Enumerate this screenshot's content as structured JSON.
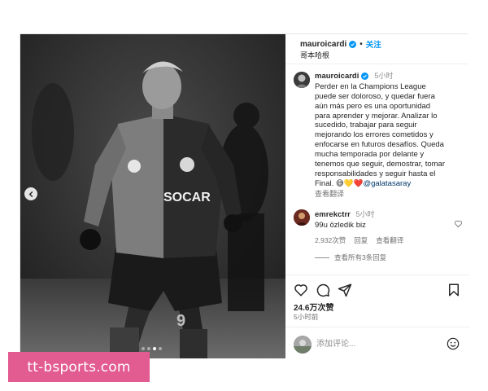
{
  "header": {
    "username": "mauroicardi",
    "dot": "•",
    "follow_label": "关注",
    "location": "哥本哈根"
  },
  "caption": {
    "username": "mauroicardi",
    "time": "5小时",
    "text": "Perder en la Champions League\npuede ser doloroso, y quedar fuera\naún más pero es una oportunidad\npara aprender y mejorar. Analizar lo\nsucedido, trabajar para seguir\nmejorando los errores cometidos y\nenfocarse en futuros desafíos. Queda\nmucha temporada por delante y\ntenemos que seguir, demostrar, tomar\nresponsabilidades y seguir hasta el\nFinal. ",
    "emojis": "😅💛❤️",
    "mention": "@galatasaray",
    "translate_label": "查看翻译"
  },
  "comment": {
    "username": "emrekctrr",
    "time": "5小时",
    "text": "99u özledik biz",
    "likes": "2,932次赞",
    "reply_label": "回复",
    "translate_label": "查看翻译",
    "view_replies": "查看所有3条回复"
  },
  "footer": {
    "likes": "24.6万次赞",
    "posted": "5小时前",
    "comment_placeholder": "添加评论..."
  },
  "photo": {
    "jersey_text": "SOCAR",
    "slide_count": 4,
    "active_slide": 3
  },
  "watermark": {
    "text": "tt-bsports.com"
  },
  "colors": {
    "follow_blue": "#0095f6",
    "mention_blue": "#00376b",
    "verified_blue": "#0095f6",
    "watermark_pink": "#e25b91"
  }
}
